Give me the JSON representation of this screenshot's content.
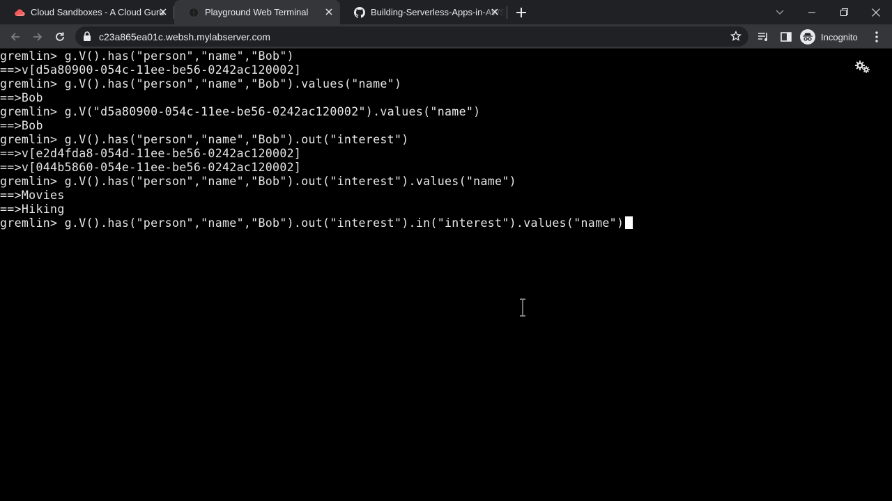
{
  "browser": {
    "tabs": [
      {
        "title": "Cloud Sandboxes - A Cloud Guru",
        "favicon": "cloud-icon",
        "active": false
      },
      {
        "title": "Playground Web Terminal",
        "favicon": "terminal-globe-icon",
        "active": true
      },
      {
        "title": "Building-Serverless-Apps-in-AWS",
        "favicon": "github-icon",
        "active": false
      }
    ],
    "new_tab_icon": "plus-icon",
    "window_controls": [
      "tab-search-icon",
      "minimize-icon",
      "restore-icon",
      "close-icon"
    ],
    "url": "c23a865ea01c.websh.mylabserver.com",
    "profile_label": "Incognito"
  },
  "terminal": {
    "lines": [
      "gremlin> g.V().has(\"person\",\"name\",\"Bob\")",
      "==>v[d5a80900-054c-11ee-be56-0242ac120002]",
      "gremlin> g.V().has(\"person\",\"name\",\"Bob\").values(\"name\")",
      "==>Bob",
      "gremlin> g.V(\"d5a80900-054c-11ee-be56-0242ac120002\").values(\"name\")",
      "==>Bob",
      "gremlin> g.V().has(\"person\",\"name\",\"Bob\").out(\"interest\")",
      "==>v[e2d4fda8-054d-11ee-be56-0242ac120002]",
      "==>v[044b5860-054e-11ee-be56-0242ac120002]",
      "gremlin> g.V().has(\"person\",\"name\",\"Bob\").out(\"interest\").values(\"name\")",
      "==>Movies",
      "==>Hiking"
    ],
    "current_input": "gremlin> g.V().has(\"person\",\"name\",\"Bob\").out(\"interest\").in(\"interest\").values(\"name\")",
    "settings_icon": "gears-icon"
  },
  "colors": {
    "tabstrip_bg": "#202124",
    "toolbar_bg": "#35363a",
    "terminal_bg": "#000000",
    "terminal_fg": "#e6e6e6"
  }
}
